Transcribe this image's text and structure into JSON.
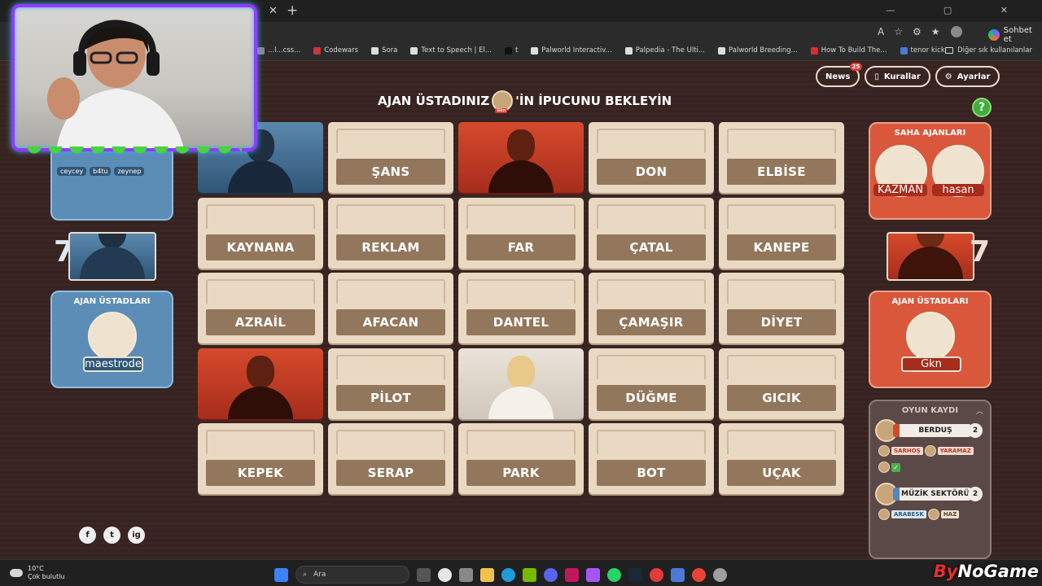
{
  "browser": {
    "bookmarks": [
      {
        "label": "...l...css...",
        "color": "#888888"
      },
      {
        "label": "Codewars",
        "color": "#c7383b"
      },
      {
        "label": "Sora",
        "color": "#dddddd"
      },
      {
        "label": "Text to Speech | El...",
        "color": "#dddddd"
      },
      {
        "label": "t",
        "color": "#111111"
      },
      {
        "label": "Palworld Interactiv...",
        "color": "#dddddd"
      },
      {
        "label": "Palpedia - The Ulti...",
        "color": "#dddddd"
      },
      {
        "label": "Palworld Breeding...",
        "color": "#dddddd"
      },
      {
        "label": "How To Build The...",
        "color": "#e02a2a"
      },
      {
        "label": "tenor kick",
        "color": "#4a79d6"
      }
    ],
    "other_bookmarks": "Diğer sık kullanılanlar",
    "copilot": "Sohbet et"
  },
  "header": {
    "news": "News",
    "news_badge": "25",
    "rules": "Kurallar",
    "settings": "Ayarlar",
    "headline_left": "AJAN ÜSTADINIZ",
    "headline_right": "'İN İPUCUNU BEKLEYİN",
    "spymaster_tag": "Gkn",
    "help": "?"
  },
  "board": {
    "cards": [
      {
        "word": "",
        "state": "blue"
      },
      {
        "word": "ŞANS",
        "state": "hidden"
      },
      {
        "word": "",
        "state": "red"
      },
      {
        "word": "DON",
        "state": "hidden"
      },
      {
        "word": "ELBİSE",
        "state": "hidden"
      },
      {
        "word": "KAYNANA",
        "state": "hidden"
      },
      {
        "word": "REKLAM",
        "state": "hidden"
      },
      {
        "word": "FAR",
        "state": "hidden"
      },
      {
        "word": "ÇATAL",
        "state": "hidden"
      },
      {
        "word": "KANEPE",
        "state": "hidden"
      },
      {
        "word": "AZRAİL",
        "state": "hidden"
      },
      {
        "word": "AFACAN",
        "state": "hidden"
      },
      {
        "word": "DANTEL",
        "state": "hidden"
      },
      {
        "word": "ÇAMAŞIR",
        "state": "hidden"
      },
      {
        "word": "DİYET",
        "state": "hidden"
      },
      {
        "word": "",
        "state": "red"
      },
      {
        "word": "PİLOT",
        "state": "hidden"
      },
      {
        "word": "",
        "state": "neutral"
      },
      {
        "word": "DÜĞME",
        "state": "hidden"
      },
      {
        "word": "GICIK",
        "state": "hidden"
      },
      {
        "word": "KEPEK",
        "state": "hidden"
      },
      {
        "word": "SERAP",
        "state": "hidden"
      },
      {
        "word": "PARK",
        "state": "hidden"
      },
      {
        "word": "BOT",
        "state": "hidden"
      },
      {
        "word": "UÇAK",
        "state": "hidden"
      }
    ]
  },
  "blue_team": {
    "operatives": [
      "ceycey",
      "b4tu",
      "zeynep"
    ],
    "remaining": "7",
    "spymasters_title": "AJAN ÜSTADLARI",
    "spymaster": "maestrode"
  },
  "red_team": {
    "field_title": "SAHA AJANLARI",
    "operatives": [
      "KAZMAN",
      "hasan"
    ],
    "remaining": "7",
    "spymasters_title": "AJAN ÜSTADLARI",
    "spymaster": "Gkn"
  },
  "log": {
    "title": "OYUN KAYDI",
    "clues": [
      {
        "team": "red",
        "player": "Gkn",
        "word": "BERDUŞ",
        "number": "2",
        "guesses": [
          {
            "word": "SARHOŞ",
            "team": "red"
          },
          {
            "word": "YARAMAZ",
            "team": "red"
          }
        ]
      },
      {
        "team": "blue",
        "player": "maestrock",
        "word": "MÜZİK SEKTÖRÜ",
        "number": "2",
        "guesses": [
          {
            "word": "ARABESK",
            "team": "blue"
          },
          {
            "word": "HAZ",
            "team": "neutral"
          }
        ]
      }
    ]
  },
  "socials": [
    "f",
    "t",
    "ig"
  ],
  "taskbar": {
    "temp": "10°C",
    "weather": "Çok bulutlu",
    "search": "Ara",
    "brand_a": "By",
    "brand_b": "NoGame"
  }
}
